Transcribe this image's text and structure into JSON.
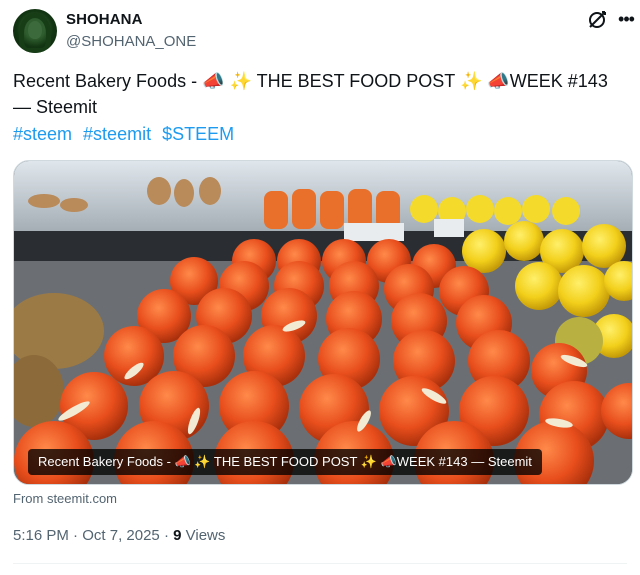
{
  "author": {
    "name": "SHOHANA",
    "handle": "@SHOHANA_ONE",
    "avatar_icon": "hooded-avatar"
  },
  "header_icons": [
    "grok-icon",
    "more-icon"
  ],
  "tweet": {
    "text_line1": "Recent Bakery Foods - 📣 ✨ THE BEST FOOD POST ✨ 📣WEEK #143",
    "text_line2": "— Steemit",
    "hashtags": [
      "#steem",
      "#steemit",
      "$STEEM"
    ]
  },
  "card": {
    "title": "Recent Bakery Foods - 📣 ✨ THE BEST FOOD POST ✨ 📣WEEK #143 — Steemit",
    "source": "From steemit.com",
    "image_subject": "sweets-display"
  },
  "meta": {
    "time": "5:16 PM",
    "separator": "·",
    "date": "Oct 7, 2025",
    "views_count": "9",
    "views_label": "Views"
  },
  "colors": {
    "link": "#1d9bf0",
    "secondary_text": "#536471",
    "primary_text": "#0f1419"
  }
}
